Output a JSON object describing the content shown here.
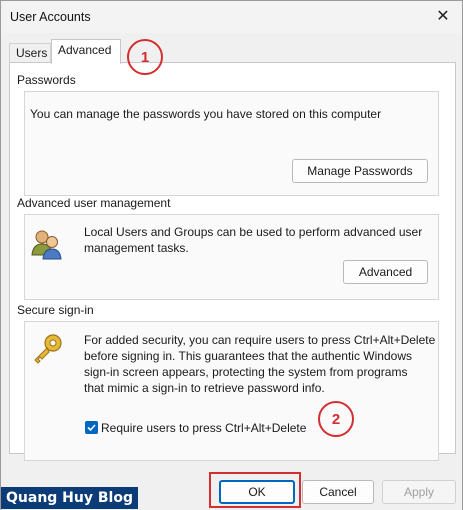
{
  "window": {
    "title": "User Accounts",
    "close_glyph": "✕"
  },
  "tabs": [
    {
      "label": "Users",
      "selected": false
    },
    {
      "label": "Advanced",
      "selected": true
    }
  ],
  "passwords": {
    "heading": "Passwords",
    "description": "You can manage the passwords you have stored on this computer",
    "button_label": "Manage Passwords"
  },
  "advanced_user_mgmt": {
    "heading": "Advanced user management",
    "description_line1": "Local Users and Groups can be used to perform advanced user",
    "description_line2": "management tasks.",
    "button_label": "Advanced",
    "icon": "users-icon"
  },
  "secure_signin": {
    "heading": "Secure sign-in",
    "description_line1": "For added security, you can require users to press Ctrl+Alt+Delete",
    "description_line2": "before signing in. This guarantees that the authentic Windows",
    "description_line3": "sign-in screen appears, protecting the system from programs",
    "description_line4": "that mimic a sign-in to retrieve password info.",
    "checkbox_label": "Require users to press Ctrl+Alt+Delete",
    "checkbox_checked": true,
    "icon": "key-icon"
  },
  "footer": {
    "ok_label": "OK",
    "cancel_label": "Cancel",
    "apply_label": "Apply"
  },
  "annotations": {
    "marker1": "1",
    "marker2": "2"
  },
  "watermark": "Quang Huy Blog",
  "colors": {
    "accent": "#0067c0",
    "annotation": "#d32f2f",
    "watermark_bg": "#0c3c78"
  }
}
